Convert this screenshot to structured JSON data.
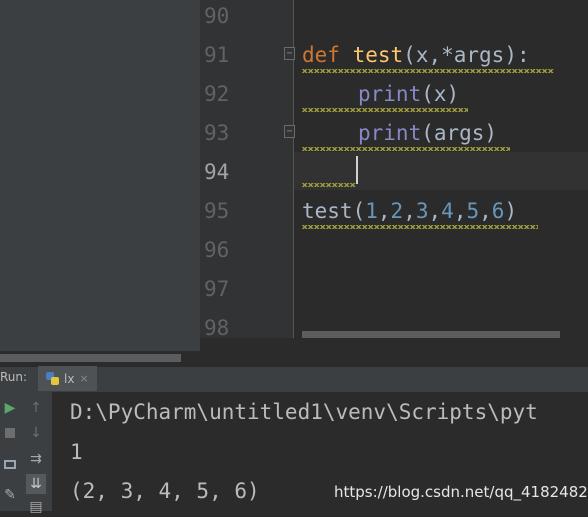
{
  "editor": {
    "line_numbers": [
      "90",
      "91",
      "92",
      "93",
      "94",
      "95",
      "96",
      "97",
      "98"
    ],
    "current_line": "94",
    "code": {
      "line91": {
        "kw": "def",
        "fn": "test",
        "rest": "(x,*args):"
      },
      "line92": {
        "builtin": "print",
        "rest": "(x)"
      },
      "line93": {
        "builtin": "print",
        "rest": "(args)"
      },
      "line95": {
        "name": "test",
        "open": "(",
        "nums": [
          "1",
          "2",
          "3",
          "4",
          "5",
          "6"
        ],
        "close": ")"
      }
    },
    "fold_icons": [
      "fold-minus",
      "fold-minus"
    ]
  },
  "run_panel": {
    "label": "Run:",
    "tab_label": "lx",
    "tab_close": "×",
    "tools": [
      "play-icon",
      "stop-icon",
      "layout-icon",
      "pin-icon",
      "arrow-up-icon",
      "arrow-down-icon",
      "wrap-icon",
      "scroll-end-icon",
      "print-icon"
    ],
    "console_lines": [
      "D:\\PyCharm\\untitled1\\venv\\Scripts\\pyt",
      "1",
      "(2, 3, 4, 5, 6)"
    ]
  },
  "watermark": "https://blog.csdn.net/qq_41824825",
  "colors": {
    "background": "#2b2b2b",
    "keyword": "#cc7832",
    "function": "#ffc66d",
    "builtin": "#8888c6",
    "number": "#6897bb",
    "run_green": "#59a869"
  }
}
